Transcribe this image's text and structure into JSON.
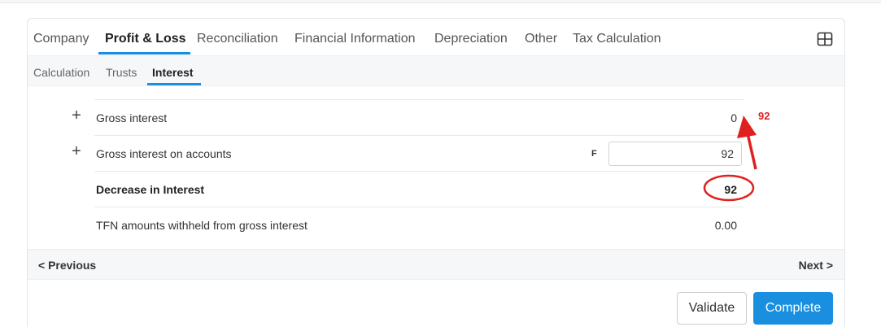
{
  "tabs": [
    {
      "label": "Company"
    },
    {
      "label": "Profit & Loss"
    },
    {
      "label": "Reconciliation"
    },
    {
      "label": "Financial Information"
    },
    {
      "label": "Depreciation"
    },
    {
      "label": "Other"
    },
    {
      "label": "Tax Calculation"
    }
  ],
  "active_tab": "Profit & Loss",
  "subtabs": [
    {
      "label": "Calculation"
    },
    {
      "label": "Trusts"
    },
    {
      "label": "Interest"
    }
  ],
  "active_subtab": "Interest",
  "rows": [
    {
      "label": "Gross interest",
      "value": "0",
      "expandable": true
    },
    {
      "label": "Gross interest on accounts",
      "flag": "F",
      "input_value": "92",
      "expandable": true
    },
    {
      "label": "Decrease in Interest",
      "value": "92",
      "bold": true
    },
    {
      "label": "TFN amounts withheld from gross interest",
      "value": "0.00"
    }
  ],
  "nav": {
    "previous": "< Previous",
    "next": "Next >"
  },
  "buttons": {
    "validate": "Validate",
    "complete": "Complete"
  },
  "annotation": {
    "text": "92",
    "color": "#e02020"
  },
  "colors": {
    "accent": "#1a8fe0",
    "annotation": "#e02020"
  },
  "icons": {
    "layout_toggle": "grid-layout-icon",
    "expand": "plus-icon"
  }
}
